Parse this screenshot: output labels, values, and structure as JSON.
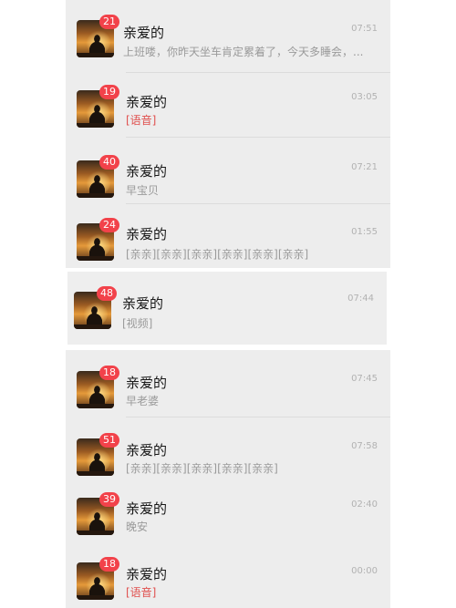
{
  "chats": [
    {
      "name": "亲爱的",
      "preview": "上班喽，你昨天坐车肯定累着了，今天多睡会，...",
      "time": "07:51",
      "badge": "21",
      "preview_color": "#9a9a9a"
    },
    {
      "name": "亲爱的",
      "preview": "[语音]",
      "time": "03:05",
      "badge": "19",
      "preview_color": "#e0504e"
    },
    {
      "name": "亲爱的",
      "preview": "早宝贝",
      "time": "07:21",
      "badge": "40",
      "preview_color": "#9a9a9a"
    },
    {
      "name": "亲爱的",
      "preview": "[亲亲][亲亲][亲亲][亲亲][亲亲][亲亲]",
      "time": "01:55",
      "badge": "24",
      "preview_color": "#9a9a9a"
    },
    {
      "name": "亲爱的",
      "preview": "[视频]",
      "time": "07:44",
      "badge": "48",
      "preview_color": "#9a9a9a"
    },
    {
      "name": "亲爱的",
      "preview": "早老婆",
      "time": "07:45",
      "badge": "18",
      "preview_color": "#9a9a9a"
    },
    {
      "name": "亲爱的",
      "preview": "[亲亲][亲亲][亲亲][亲亲][亲亲]",
      "time": "07:58",
      "badge": "51",
      "preview_color": "#9a9a9a"
    },
    {
      "name": "亲爱的",
      "preview": "晚安",
      "time": "02:40",
      "badge": "39",
      "preview_color": "#9a9a9a"
    },
    {
      "name": "亲爱的",
      "preview": "[语音]",
      "time": "00:00",
      "badge": "18",
      "preview_color": "#e0504e"
    }
  ],
  "colors": {
    "badge": "#f2424a",
    "voice_preview": "#e0504e",
    "background": "#ededed"
  },
  "avatar_icon": "silhouette-sunset-avatar"
}
